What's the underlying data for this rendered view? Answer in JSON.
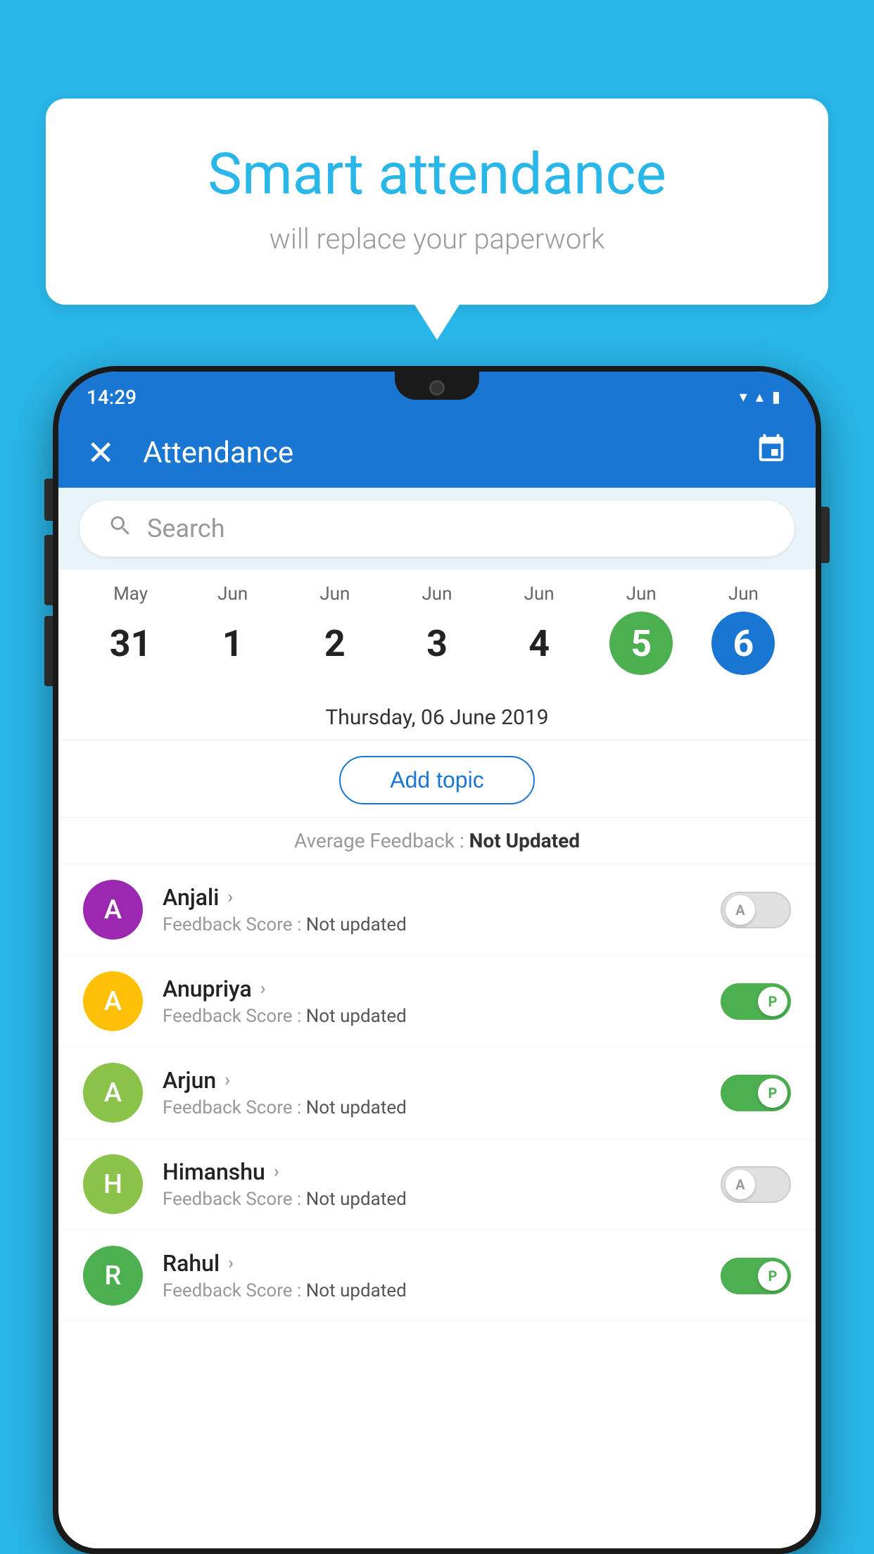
{
  "background": {
    "color": "#29b6e8"
  },
  "speech_bubble": {
    "title": "Smart attendance",
    "subtitle": "will replace your paperwork"
  },
  "status_bar": {
    "time": "14:29",
    "icons": [
      "wifi",
      "signal",
      "battery"
    ]
  },
  "app_bar": {
    "title": "Attendance",
    "close_label": "✕",
    "calendar_icon": "📅"
  },
  "search": {
    "placeholder": "Search"
  },
  "calendar": {
    "days": [
      {
        "month": "May",
        "day": "31",
        "state": "normal"
      },
      {
        "month": "Jun",
        "day": "1",
        "state": "normal"
      },
      {
        "month": "Jun",
        "day": "2",
        "state": "normal"
      },
      {
        "month": "Jun",
        "day": "3",
        "state": "normal"
      },
      {
        "month": "Jun",
        "day": "4",
        "state": "normal"
      },
      {
        "month": "Jun",
        "day": "5",
        "state": "today"
      },
      {
        "month": "Jun",
        "day": "6",
        "state": "selected"
      }
    ],
    "selected_date": "Thursday, 06 June 2019"
  },
  "add_topic": {
    "label": "Add topic"
  },
  "average_feedback": {
    "label": "Average Feedback : ",
    "value": "Not Updated"
  },
  "students": [
    {
      "name": "Anjali",
      "initial": "A",
      "avatar_color": "#9c27b0",
      "feedback_label": "Feedback Score : ",
      "feedback_value": "Not updated",
      "attendance": "absent",
      "toggle_label": "A"
    },
    {
      "name": "Anupriya",
      "initial": "A",
      "avatar_color": "#ffc107",
      "feedback_label": "Feedback Score : ",
      "feedback_value": "Not updated",
      "attendance": "present",
      "toggle_label": "P"
    },
    {
      "name": "Arjun",
      "initial": "A",
      "avatar_color": "#8bc34a",
      "feedback_label": "Feedback Score : ",
      "feedback_value": "Not updated",
      "attendance": "present",
      "toggle_label": "P"
    },
    {
      "name": "Himanshu",
      "initial": "H",
      "avatar_color": "#8bc34a",
      "feedback_label": "Feedback Score : ",
      "feedback_value": "Not updated",
      "attendance": "absent",
      "toggle_label": "A"
    },
    {
      "name": "Rahul",
      "initial": "R",
      "avatar_color": "#4caf50",
      "feedback_label": "Feedback Score : ",
      "feedback_value": "Not updated",
      "attendance": "present",
      "toggle_label": "P"
    }
  ]
}
